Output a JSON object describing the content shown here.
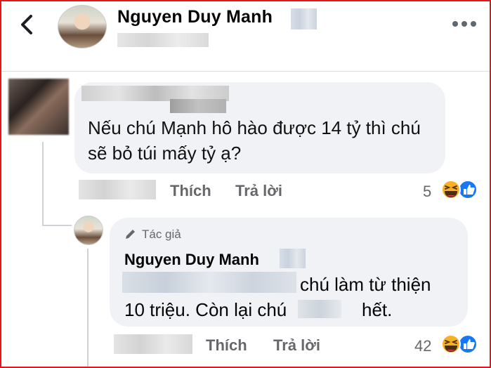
{
  "header": {
    "name": "Nguyen Duy Manh",
    "back_icon": "chevron-left-icon",
    "more_icon": "more-dots-icon"
  },
  "comment": {
    "text": "Nếu chú Mạnh hô hào được 14 tỷ thì chú sẽ bỏ túi mấy tỷ ạ?",
    "like_label": "Thích",
    "reply_label": "Trả lời",
    "reaction_count": "5"
  },
  "reply": {
    "author_label": "Tác giả",
    "name": "Nguyen Duy Manh",
    "text_part1": "chú làm từ thiện",
    "text_part2": "10 triệu. Còn lại chú",
    "text_part3": "hết.",
    "like_label": "Thích",
    "reply_label": "Trả lời",
    "reaction_count": "42"
  },
  "colors": {
    "frame_border": "#e8141c",
    "bubble": "#f0f2f5",
    "secondary_text": "#65676b",
    "like_blue": "#1877f2",
    "haha_yellow": "#f7b125"
  }
}
